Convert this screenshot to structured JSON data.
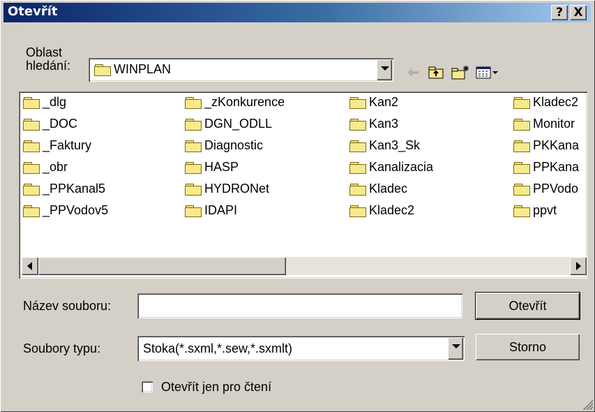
{
  "dialog": {
    "title": "Otevřít",
    "help_label": "?",
    "close_label": "X"
  },
  "look_in": {
    "label_line1": "Oblast",
    "label_line2": "hledání:",
    "value": "WINPLAN"
  },
  "toolbar": {
    "icons": [
      "back-icon",
      "up-folder-icon",
      "new-folder-icon",
      "view-menu-icon"
    ]
  },
  "files": {
    "col1": [
      "_dlg",
      "_DOC",
      "_Faktury",
      "_obr",
      "_PPKanal5",
      "_PPVodov5"
    ],
    "col2": [
      "_zKonkurence",
      "DGN_ODLL",
      "Diagnostic",
      "HASP",
      "HYDRONet",
      "IDAPI"
    ],
    "col3": [
      "Kan2",
      "Kan3",
      "Kan3_Sk",
      "Kanalizacia",
      "Kladec",
      "Kladec2"
    ],
    "col4": [
      "Kladec2",
      "Monitor",
      "PKKana",
      "PPKana",
      "PPVodo",
      "ppvt"
    ]
  },
  "filename": {
    "label": "Název souboru:",
    "value": ""
  },
  "filetype": {
    "label": "Soubory typu:",
    "value": "Stoka(*.sxml,*.sew,*.sxmlt)"
  },
  "buttons": {
    "open": "Otevřít",
    "cancel": "Storno"
  },
  "readonly": {
    "label": "Otevřít jen pro čtení",
    "checked": false
  },
  "colors": {
    "titlebar_start": "#0a246a",
    "titlebar_end": "#a6caf0",
    "face": "#d4d0c8",
    "folder": "#f7e98c"
  }
}
